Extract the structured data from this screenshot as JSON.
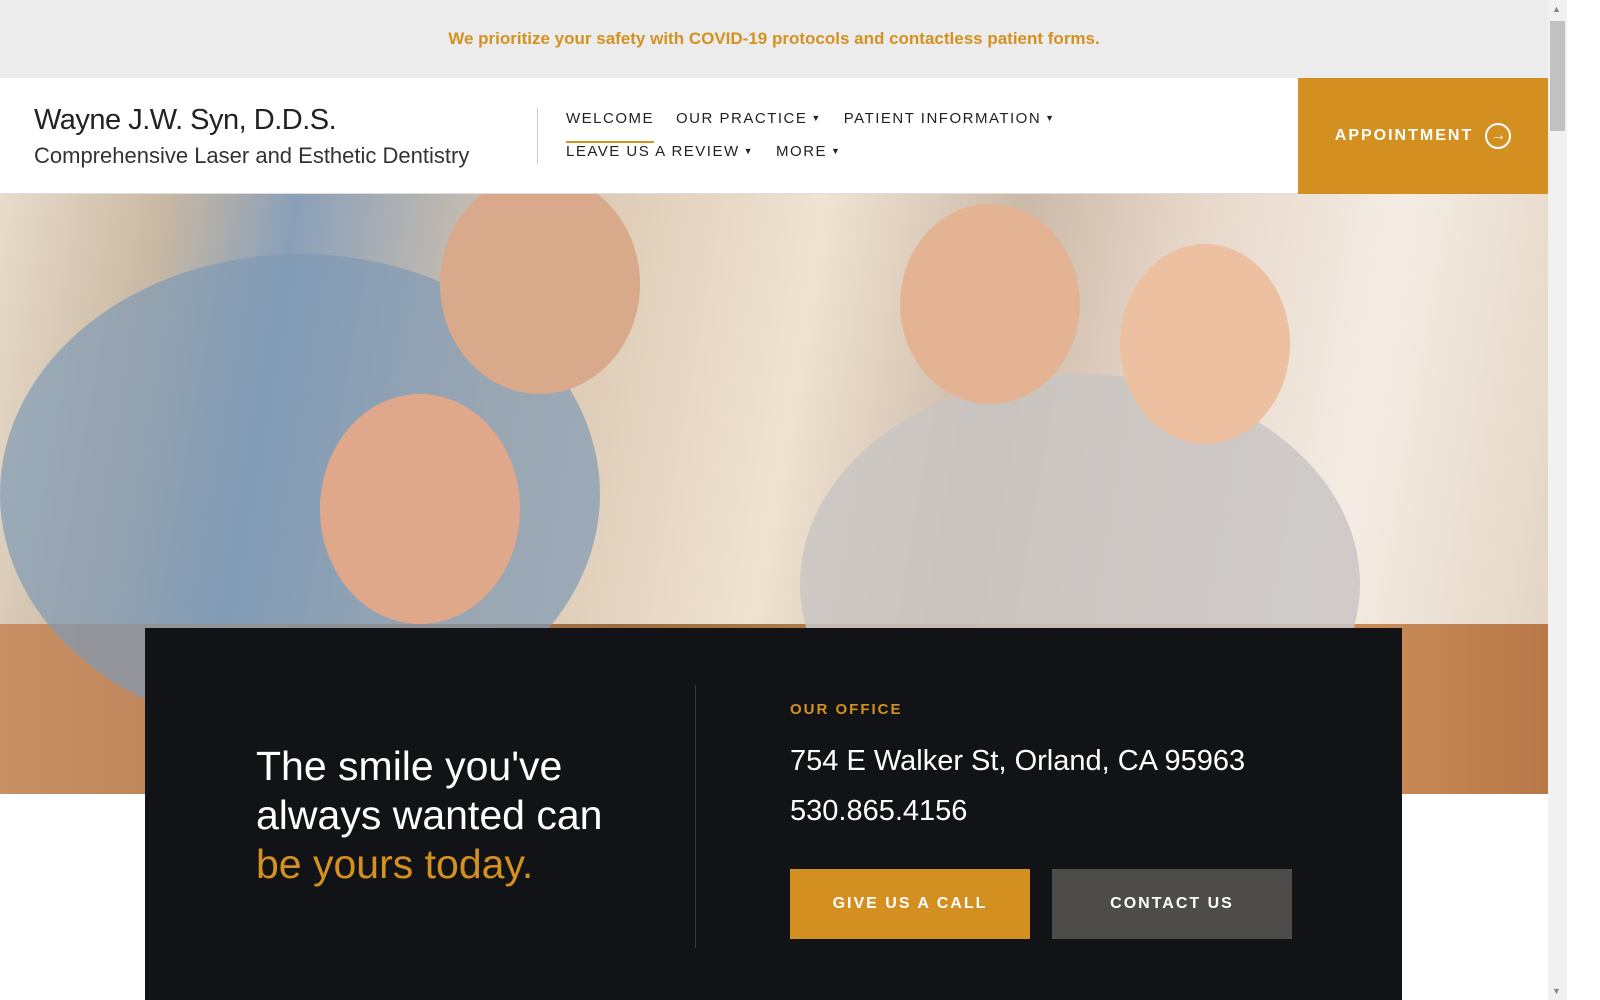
{
  "banner": {
    "text": "We prioritize your safety with COVID-19 protocols and contactless patient forms."
  },
  "brand": {
    "name": "Wayne J.W. Syn, D.D.S.",
    "tagline": "Comprehensive Laser and Esthetic Dentistry"
  },
  "nav": {
    "items": [
      {
        "label": "WELCOME",
        "active": true
      },
      {
        "label": "OUR PRACTICE",
        "dropdown": true
      },
      {
        "label": "PATIENT INFORMATION",
        "dropdown": true
      },
      {
        "label": "LEAVE US A REVIEW",
        "dropdown": true
      },
      {
        "label": "MORE",
        "dropdown": true
      }
    ]
  },
  "appointment": {
    "label": "APPOINTMENT",
    "icon": "arrow-right-circle-icon"
  },
  "hero": {
    "line1": "The smile you've",
    "line2": "always wanted can",
    "highlight": "be yours today."
  },
  "office": {
    "label": "OUR OFFICE",
    "address": "754 E Walker St, Orland, CA 95963",
    "phone": "530.865.4156"
  },
  "buttons": {
    "call": "GIVE US A CALL",
    "contact": "CONTACT US"
  },
  "colors": {
    "accent": "#d48f21",
    "dark": "#121316",
    "secondary_button": "#4e4c48"
  }
}
